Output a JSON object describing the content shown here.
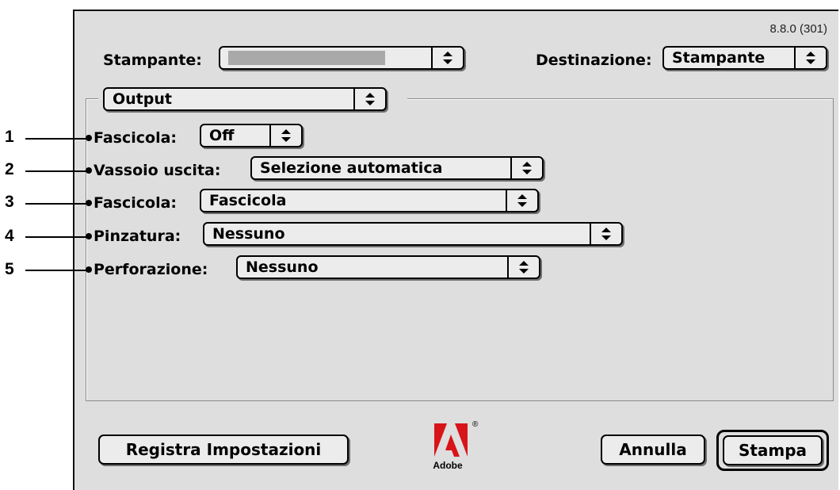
{
  "version": "8.8.0 (301)",
  "header": {
    "printer_label": "Stampante:",
    "printer_value": "",
    "destination_label": "Destinazione:",
    "destination_value": "Stampante"
  },
  "panel": {
    "section_value": "Output"
  },
  "fields": [
    {
      "callout": "1",
      "label": "Fascicola:",
      "value": "Off"
    },
    {
      "callout": "2",
      "label": "Vassoio uscita:",
      "value": "Selezione automatica"
    },
    {
      "callout": "3",
      "label": "Fascicola:",
      "value": "Fascicola"
    },
    {
      "callout": "4",
      "label": "Pinzatura:",
      "value": "Nessuno"
    },
    {
      "callout": "5",
      "label": "Perforazione:",
      "value": "Nessuno"
    }
  ],
  "buttons": {
    "save_settings": "Registra Impostazioni",
    "cancel": "Annulla",
    "print": "Stampa"
  },
  "logo": {
    "text": "Adobe",
    "mark": "®",
    "color": "#d7141a"
  },
  "icons": {
    "popup_arrow": "up-down-arrows-icon"
  }
}
